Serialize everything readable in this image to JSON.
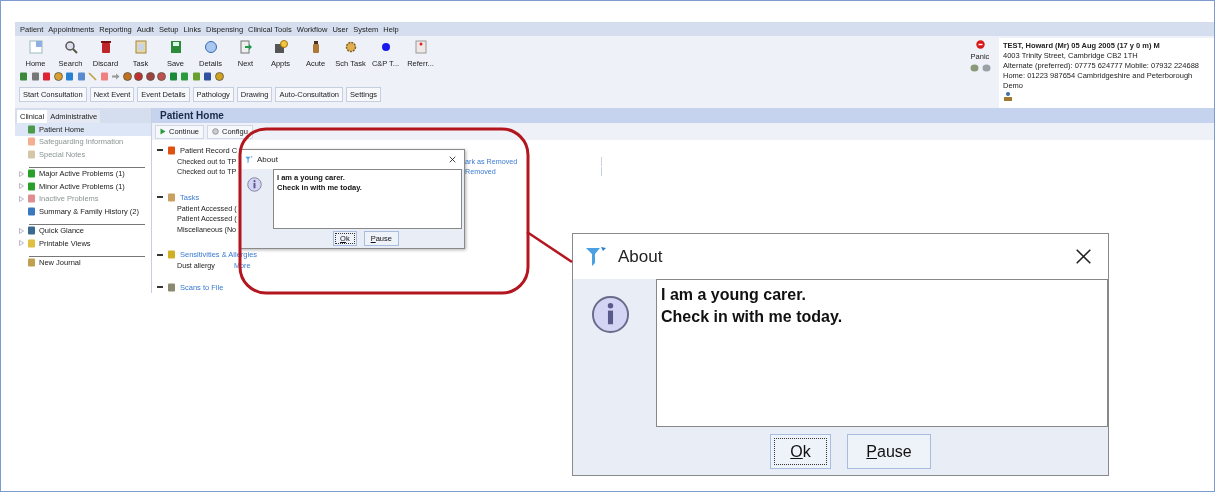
{
  "menu": [
    "Patient",
    "Appointments",
    "Reporting",
    "Audit",
    "Setup",
    "Links",
    "Dispensing",
    "Clinical Tools",
    "Workflow",
    "User",
    "System",
    "Help"
  ],
  "toolbar": [
    "Home",
    "Search",
    "Discard",
    "Task",
    "Save",
    "Details",
    "Next",
    "Appts",
    "Acute",
    "Sch Task",
    "C&P T...",
    "Referr..."
  ],
  "action_buttons": [
    "Start Consultation",
    "Next Event",
    "Event Details",
    "Pathology",
    "Drawing",
    "Auto-Consultation",
    "Settings"
  ],
  "panic": {
    "label": "Panic"
  },
  "patient": {
    "name": "TEST, Howard (Mr) 05 Aug 2005 (17 y  0 m) M",
    "lines": [
      "4003 Trinity Street, Cambridge CB2 1TH",
      "Alternate (preferred): 07775 624777 Mobile: 07932 224688",
      "Home: 01223 987654   Cambridgeshire and Peterborough",
      "Demo"
    ]
  },
  "sidebar": {
    "tabs": [
      {
        "label": "Clinical",
        "selected": true
      },
      {
        "label": "Administrative",
        "selected": false
      }
    ],
    "groups": [
      [
        {
          "label": "Patient Home",
          "kind": "leaf",
          "selected": true,
          "disabled": false
        },
        {
          "label": "Safeguarding Information",
          "kind": "leaf",
          "selected": false,
          "disabled": true
        },
        {
          "label": "Special Notes",
          "kind": "leaf",
          "selected": false,
          "disabled": true
        }
      ],
      [
        {
          "label": "Major Active Problems (1)",
          "kind": "branch",
          "selected": false,
          "disabled": false
        },
        {
          "label": "Minor Active Problems (1)",
          "kind": "branch",
          "selected": false,
          "disabled": false
        },
        {
          "label": "Inactive Problems",
          "kind": "branch",
          "selected": false,
          "disabled": true
        },
        {
          "label": "Summary & Family History (2)",
          "kind": "leaf",
          "selected": false,
          "disabled": false
        }
      ],
      [
        {
          "label": "Quick Glance",
          "kind": "branch",
          "selected": false,
          "disabled": false
        },
        {
          "label": "Printable Views",
          "kind": "branch",
          "selected": false,
          "disabled": false
        }
      ],
      [
        {
          "label": "New Journal",
          "kind": "leaf",
          "selected": false,
          "disabled": false
        }
      ]
    ]
  },
  "content": {
    "title": "Patient Home",
    "buttons": [
      "Continue",
      "Configu"
    ],
    "sections": [
      {
        "title": "Patient Record C",
        "link": false,
        "rows": [
          {
            "text": "Checked out to TP",
            "side": "ark as Removed"
          },
          {
            "text": "Checked out to TP",
            "side": "Removed"
          }
        ]
      },
      {
        "title": "Tasks",
        "link": true,
        "rows": [
          {
            "text": "Patient Accessed ("
          },
          {
            "text": "Patient Accessed ("
          },
          {
            "text": "Miscellaneous (No"
          }
        ]
      },
      {
        "title": "Sensitivities & Allergies",
        "link": true,
        "rows": [
          {
            "text": "Dust allergy",
            "more": "More"
          }
        ]
      },
      {
        "title": "Scans to File",
        "link": true
      }
    ]
  },
  "dialog": {
    "title": "About",
    "message": [
      "I am a young carer.",
      "Check in with me today."
    ],
    "buttons": [
      "Ok",
      "Pause"
    ]
  },
  "zoomed_dialog": {
    "title": "About",
    "message": [
      "I am a young carer.",
      "Check in with me today."
    ],
    "buttons": [
      "Ok",
      "Pause"
    ]
  }
}
